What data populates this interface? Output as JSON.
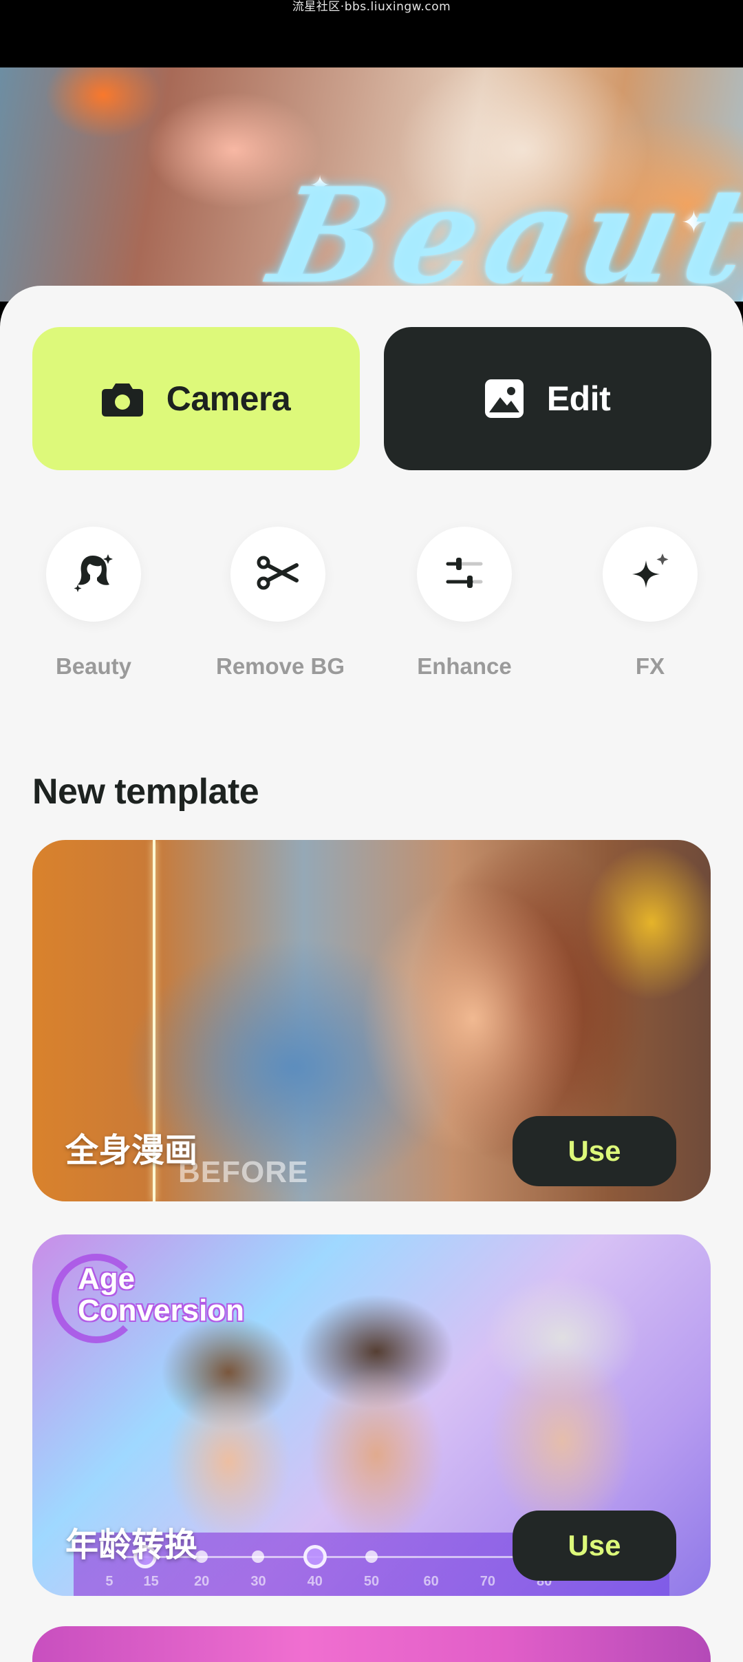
{
  "status_bar": {
    "watermark": "流星社区·bbs.liuxingw.com"
  },
  "hero": {
    "word": "Beauty"
  },
  "primary_actions": [
    {
      "label": "Camera",
      "icon": "camera-icon",
      "color": "#ddf97a"
    },
    {
      "label": "Edit",
      "icon": "image-icon",
      "color": "#222726"
    }
  ],
  "tools": [
    {
      "label": "Beauty",
      "icon": "face-sparkle-icon"
    },
    {
      "label": "Remove BG",
      "icon": "scissors-icon"
    },
    {
      "label": "Enhance",
      "icon": "sliders-icon"
    },
    {
      "label": "FX",
      "icon": "sparkle-icon"
    }
  ],
  "section": {
    "title": "New template"
  },
  "templates": [
    {
      "title": "全身漫画",
      "overlay_text": "BEFORE",
      "use_label": "Use"
    },
    {
      "title": "年龄转换",
      "badge_line1": "Age",
      "badge_line2": "Conversion",
      "use_label": "Use",
      "scale": [
        "5",
        "15",
        "20",
        "30",
        "40",
        "50",
        "60",
        "70",
        "80"
      ]
    }
  ],
  "colors": {
    "accent": "#ddf97a",
    "dark": "#222726",
    "background": "#f6f6f6"
  }
}
